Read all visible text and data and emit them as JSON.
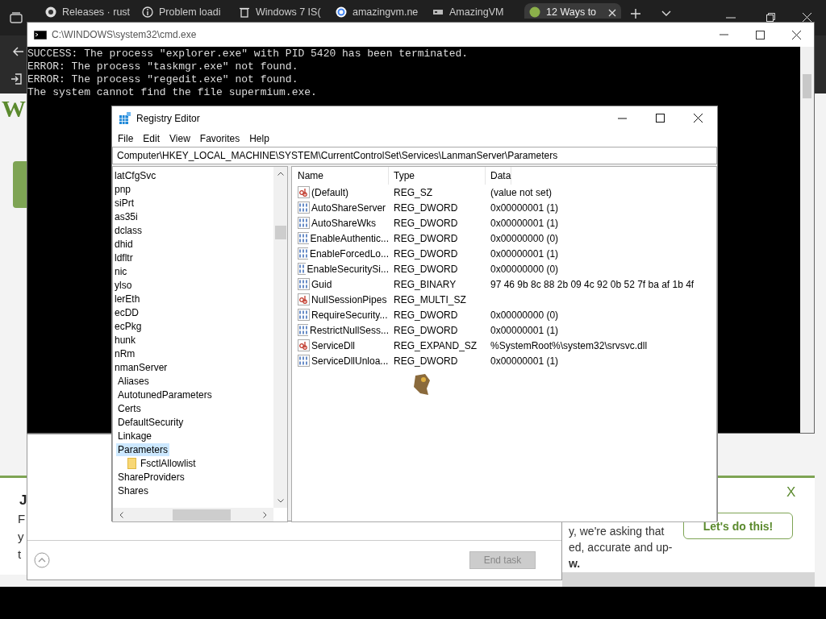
{
  "browser": {
    "tabs": [
      {
        "title": "Releases · rust",
        "kind": "github",
        "selected": false
      },
      {
        "title": "Problem loadi",
        "kind": "info",
        "selected": false
      },
      {
        "title": "Windows 7 IS(",
        "kind": "trash",
        "selected": false
      },
      {
        "title": "amazingvm.ne",
        "kind": "google",
        "selected": false
      },
      {
        "title": "AmazingVM",
        "kind": "vm",
        "selected": false
      },
      {
        "title": "12 Ways to",
        "kind": "site",
        "selected": true
      }
    ],
    "page": {
      "logo_fragment": "W",
      "banner": {
        "heading": "J",
        "left_lines": [
          "F",
          "y",
          "t"
        ],
        "right_lines": [
          "y, we're asking that",
          "ed, accurate and up-",
          "w."
        ],
        "button": "Let's do this!",
        "close": "X"
      }
    }
  },
  "cmd": {
    "title": "C:\\WINDOWS\\system32\\cmd.exe",
    "lines": [
      "SUCCESS: The process \"explorer.exe\" with PID 5420 has been terminated.",
      "ERROR: The process \"taskmgr.exe\" not found.",
      "ERROR: The process \"regedit.exe\" not found.",
      "The system cannot find the file supermium.exe."
    ]
  },
  "task_manager": {
    "button": {
      "label": "End task",
      "disabled": true
    }
  },
  "regedit": {
    "title": "Registry Editor",
    "menu": [
      "File",
      "Edit",
      "View",
      "Favorites",
      "Help"
    ],
    "address": "Computer\\HKEY_LOCAL_MACHINE\\SYSTEM\\CurrentControlSet\\Services\\LanmanServer\\Parameters",
    "tree": [
      {
        "label": "latCfgSvc",
        "selected": false
      },
      {
        "label": "pnp",
        "selected": false
      },
      {
        "label": "siPrt",
        "selected": false
      },
      {
        "label": "as35i",
        "selected": false
      },
      {
        "label": "dclass",
        "selected": false
      },
      {
        "label": "dhid",
        "selected": false
      },
      {
        "label": "ldfltr",
        "selected": false
      },
      {
        "label": "nic",
        "selected": false
      },
      {
        "label": "ylso",
        "selected": false
      },
      {
        "label": "lerEth",
        "selected": false
      },
      {
        "label": "ecDD",
        "selected": false
      },
      {
        "label": "ecPkg",
        "selected": false
      },
      {
        "label": "hunk",
        "selected": false
      },
      {
        "label": "nRm",
        "selected": false
      },
      {
        "label": "nmanServer",
        "selected": false,
        "children": [
          {
            "label": "Aliases",
            "selected": false
          },
          {
            "label": "AutotunedParameters",
            "selected": false
          },
          {
            "label": "Certs",
            "selected": false
          },
          {
            "label": "DefaultSecurity",
            "selected": false
          },
          {
            "label": "Linkage",
            "selected": false
          },
          {
            "label": "Parameters",
            "selected": true,
            "children": [
              {
                "label": "FsctlAllowlist",
                "selected": false
              }
            ]
          },
          {
            "label": "ShareProviders",
            "selected": false
          },
          {
            "label": "Shares",
            "selected": false
          }
        ]
      }
    ],
    "columns": [
      "Name",
      "Type",
      "Data"
    ],
    "rows": [
      {
        "kind": "string",
        "name": "(Default)",
        "type": "REG_SZ",
        "data": "(value not set)"
      },
      {
        "kind": "binary",
        "name": "AutoShareServer",
        "type": "REG_DWORD",
        "data": "0x00000001 (1)"
      },
      {
        "kind": "binary",
        "name": "AutoShareWks",
        "type": "REG_DWORD",
        "data": "0x00000001 (1)"
      },
      {
        "kind": "binary",
        "name": "EnableAuthentic...",
        "type": "REG_DWORD",
        "data": "0x00000000 (0)"
      },
      {
        "kind": "binary",
        "name": "EnableForcedLo...",
        "type": "REG_DWORD",
        "data": "0x00000001 (1)"
      },
      {
        "kind": "binary",
        "name": "EnableSecuritySi...",
        "type": "REG_DWORD",
        "data": "0x00000000 (0)"
      },
      {
        "kind": "binary",
        "name": "Guid",
        "type": "REG_BINARY",
        "data": "97 46 9b 8c 88 2b 09 4c 92 0b 52 7f ba af 1b 4f"
      },
      {
        "kind": "string",
        "name": "NullSessionPipes",
        "type": "REG_MULTI_SZ"
      },
      {
        "kind": "binary",
        "name": "RequireSecurity...",
        "type": "REG_DWORD",
        "data": "0x00000000 (0)"
      },
      {
        "kind": "binary",
        "name": "RestrictNullSess...",
        "type": "REG_DWORD",
        "data": "0x00000001 (1)"
      },
      {
        "kind": "string",
        "name": "ServiceDll",
        "type": "REG_EXPAND_SZ",
        "data": "%SystemRoot%\\system32\\srvsvc.dll"
      },
      {
        "kind": "binary",
        "name": "ServiceDllUnloa...",
        "type": "REG_DWORD",
        "data": "0x00000001 (1)"
      }
    ]
  }
}
